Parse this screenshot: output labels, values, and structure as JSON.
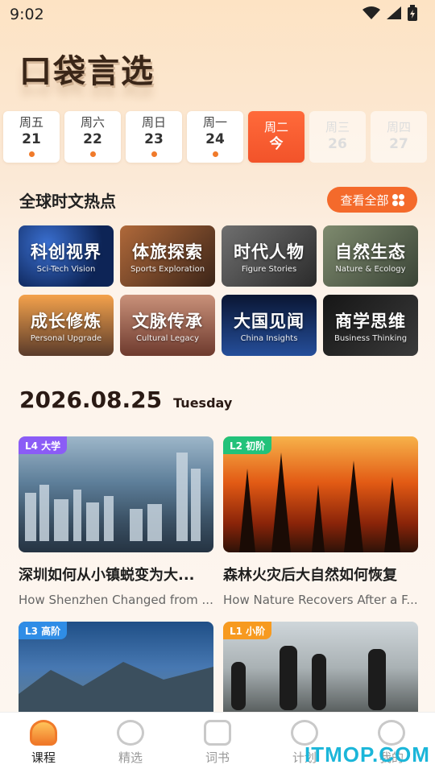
{
  "status_bar": {
    "time": "9:02",
    "icons": [
      "wifi-icon",
      "signal-icon",
      "battery-icon"
    ]
  },
  "app": {
    "logo_text": "口袋言选"
  },
  "week": [
    {
      "name": "周五",
      "num": "21",
      "has_dot": true,
      "state": "past"
    },
    {
      "name": "周六",
      "num": "22",
      "has_dot": true,
      "state": "past"
    },
    {
      "name": "周日",
      "num": "23",
      "has_dot": true,
      "state": "past"
    },
    {
      "name": "周一",
      "num": "24",
      "has_dot": true,
      "state": "past"
    },
    {
      "name": "周二",
      "num": "今",
      "has_dot": false,
      "state": "today"
    },
    {
      "name": "周三",
      "num": "26",
      "has_dot": false,
      "state": "future"
    },
    {
      "name": "周四",
      "num": "27",
      "has_dot": false,
      "state": "future"
    }
  ],
  "hot_topics": {
    "title": "全球时文热点",
    "view_all_label": "查看全部",
    "items": [
      {
        "zh": "科创视界",
        "en": "Sci-Tech Vision"
      },
      {
        "zh": "体旅探索",
        "en": "Sports Exploration"
      },
      {
        "zh": "时代人物",
        "en": "Figure Stories"
      },
      {
        "zh": "自然生态",
        "en": "Nature & Ecology"
      },
      {
        "zh": "成长修炼",
        "en": "Personal Upgrade"
      },
      {
        "zh": "文脉传承",
        "en": "Cultural Legacy"
      },
      {
        "zh": "大国见闻",
        "en": "China Insights"
      },
      {
        "zh": "商学思维",
        "en": "Business Thinking"
      }
    ]
  },
  "date_header": {
    "date": "2026.08.25",
    "weekday": "Tuesday"
  },
  "articles": [
    {
      "level": "L4 大学",
      "title": "深圳如何从小镇蜕变为大...",
      "subtitle": "How Shenzhen Changed from ...",
      "badge_color": "#8b5cf6"
    },
    {
      "level": "L2 初阶",
      "title": "森林火灾后大自然如何恢复",
      "subtitle": "How Nature Recovers After a F...",
      "badge_color": "#22c27a"
    },
    {
      "level": "L3 高阶",
      "title": "",
      "subtitle": "",
      "badge_color": "#2f8de6"
    },
    {
      "level": "L1 小阶",
      "title": "",
      "subtitle": "",
      "badge_color": "#f79a1f"
    }
  ],
  "tabs": [
    {
      "label": "课程",
      "active": true
    },
    {
      "label": "精选",
      "active": false
    },
    {
      "label": "词书",
      "active": false
    },
    {
      "label": "计划",
      "active": false
    },
    {
      "label": "我的",
      "active": false
    }
  ],
  "watermark": "ITMOP.COM"
}
